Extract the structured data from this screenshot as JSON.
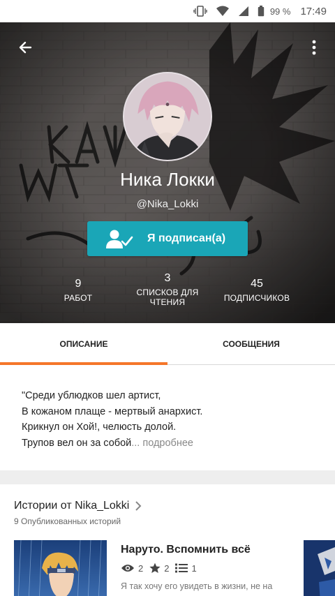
{
  "status_bar": {
    "battery_percent": "99 %",
    "time": "17:49"
  },
  "profile": {
    "name": "Ника Локки",
    "handle": "@Nika_Lokki",
    "follow_button_label": "Я подписан(а)",
    "accent_color": "#1aa6b7"
  },
  "stats": {
    "works": {
      "value": "9",
      "label": "РАБОТ"
    },
    "reading_lists": {
      "value": "3",
      "label_line1": "СПИСКОВ ДЛЯ",
      "label_line2": "ЧТЕНИЯ"
    },
    "followers": {
      "value": "45",
      "label": "ПОДПИСЧИКОВ"
    }
  },
  "tabs": {
    "description_label": "ОПИСАНИЕ",
    "messages_label": "СООБЩЕНИЯ",
    "active": "description",
    "indicator_color": "#f5762a"
  },
  "description": {
    "line1": "\"Среди ублюдков шел артист,",
    "line2": "В кожаном плаще - мертвый анархист.",
    "line3": "Крикнул он Хой!, челюсть долой.",
    "line4": "Трупов вел он за собой",
    "more_link": "... подробнее"
  },
  "stories": {
    "title": "Истории от Nika_Lokki",
    "subtitle": "9 Опубликованных историй",
    "first": {
      "title": "Наруто. Вспомнить всё",
      "views": "2",
      "votes": "2",
      "parts": "1",
      "desc_line": "Я так хочу его увидеть в жизни, не на"
    }
  },
  "icons": {
    "back": "arrow-left-icon",
    "more": "more-vertical-icon",
    "follow": "user-check-icon",
    "chevron": "chevron-right-icon",
    "views": "eye-icon",
    "votes": "star-icon",
    "parts": "list-icon"
  }
}
